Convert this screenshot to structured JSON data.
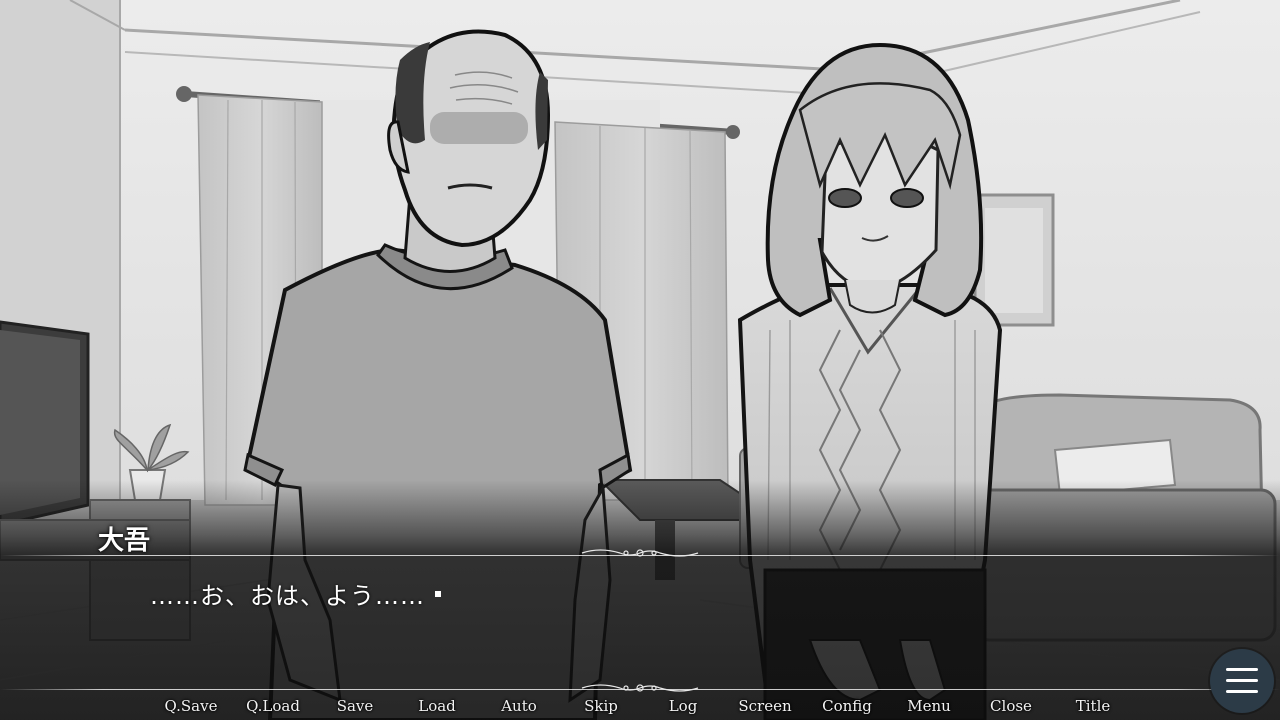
{
  "dialogue": {
    "speaker": "大吾",
    "text": "……お、おは、よう……"
  },
  "menu": {
    "items": [
      "Q.Save",
      "Q.Load",
      "Save",
      "Load",
      "Auto",
      "Skip",
      "Log",
      "Screen",
      "Config",
      "Menu",
      "Close",
      "Title"
    ]
  },
  "icons": {
    "menu_toggle": "hamburger-menu-icon",
    "advance": "text-advance-indicator"
  },
  "colors": {
    "dialogue_text": "#ffffff",
    "menu_toggle_bg": "#2c3b47"
  }
}
